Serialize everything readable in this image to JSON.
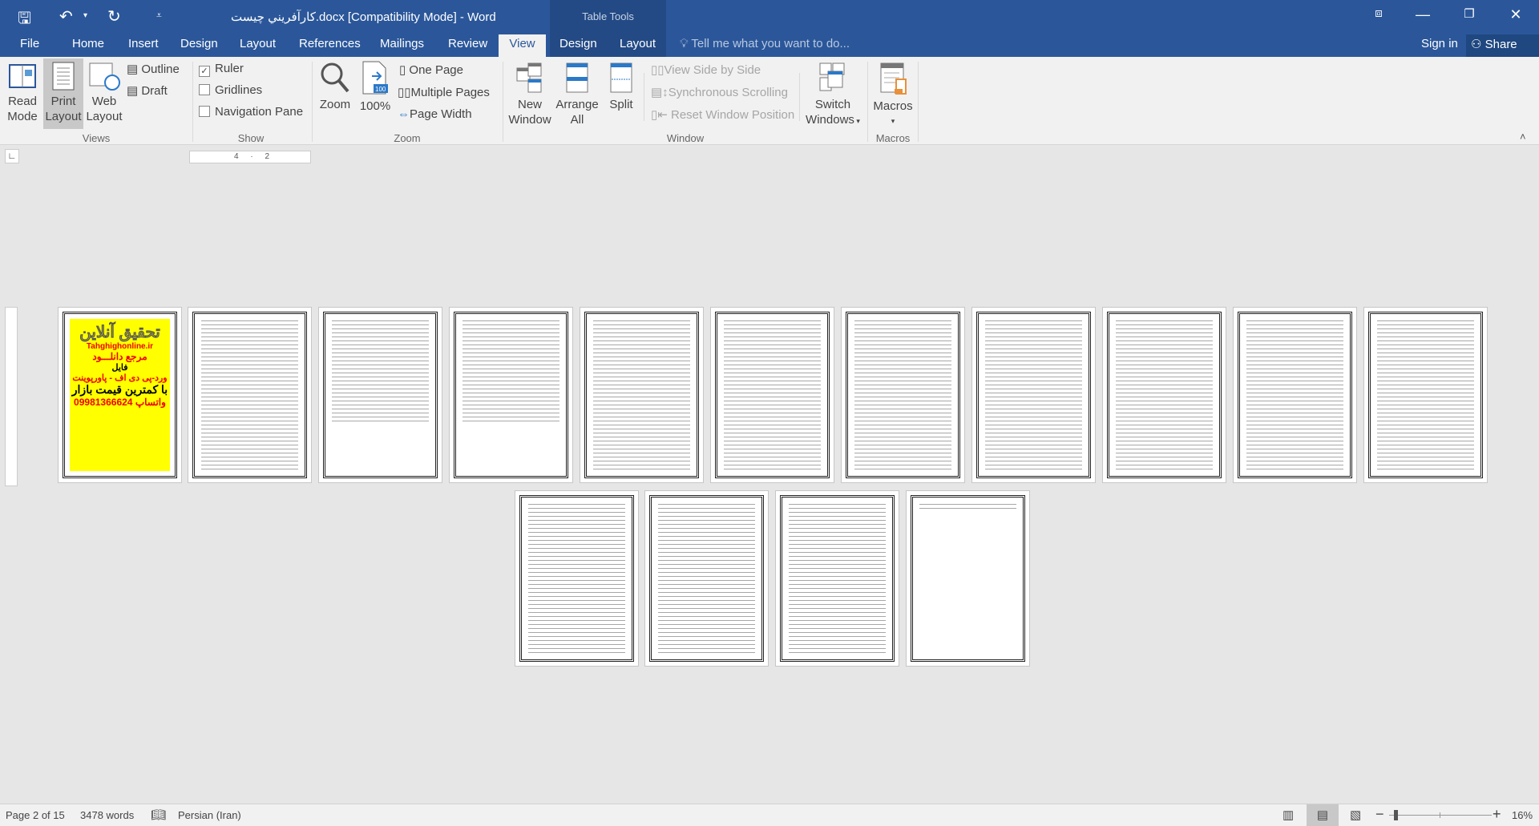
{
  "titlebar": {
    "title": "کارآفريني چيست.docx [Compatibility Mode] - Word",
    "context_tab_group": "Table Tools",
    "qat": {
      "save": "save-icon",
      "undo": "undo-icon",
      "redo": "redo-icon",
      "customize": "customize-qat-icon"
    }
  },
  "tabs": [
    "File",
    "Home",
    "Insert",
    "Design",
    "Layout",
    "References",
    "Mailings",
    "Review",
    "View",
    "Design",
    "Layout"
  ],
  "active_tab": "View",
  "tell_me": "Tell me what you want to do...",
  "sign_in": "Sign in",
  "share": "Share",
  "ribbon": {
    "views": {
      "label": "Views",
      "read_mode": [
        "Read",
        "Mode"
      ],
      "print_layout": [
        "Print",
        "Layout"
      ],
      "web_layout": [
        "Web",
        "Layout"
      ],
      "outline": "Outline",
      "draft": "Draft"
    },
    "show": {
      "label": "Show",
      "ruler": "Ruler",
      "ruler_checked": true,
      "gridlines": "Gridlines",
      "gridlines_checked": false,
      "navigation_pane": "Navigation Pane",
      "navigation_checked": false
    },
    "zoom": {
      "label": "Zoom",
      "zoom": "Zoom",
      "hundred": "100%",
      "hundred_icon_text": "100",
      "one_page": "One Page",
      "multiple_pages": "Multiple Pages",
      "page_width": "Page Width"
    },
    "window": {
      "label": "Window",
      "new_window": [
        "New",
        "Window"
      ],
      "arrange_all": [
        "Arrange",
        "All"
      ],
      "split": "Split",
      "side_by_side": "View Side by Side",
      "sync_scroll": "Synchronous Scrolling",
      "reset_position": "Reset Window Position",
      "switch_windows": [
        "Switch",
        "Windows"
      ]
    },
    "macros": {
      "label": "Macros",
      "macros": "Macros"
    }
  },
  "ruler": {
    "marks": "4 · 2"
  },
  "cover_page": {
    "title": "تحقيق آنلاين",
    "site": "Tahghighonline.ir",
    "line1": "مرجع دانلـــود",
    "line2": "فايل",
    "line3": "ورد-پی دی اف - پاورپوينت",
    "line4": "با کمترين قيمت بازار",
    "phone": "09981366624",
    "whatsapp": "واتساپ"
  },
  "document": {
    "page_count": 15
  },
  "status": {
    "page": "Page 2 of 15",
    "words": "3478 words",
    "language": "Persian (Iran)",
    "zoom": "16%",
    "zoom_percent": 16
  }
}
